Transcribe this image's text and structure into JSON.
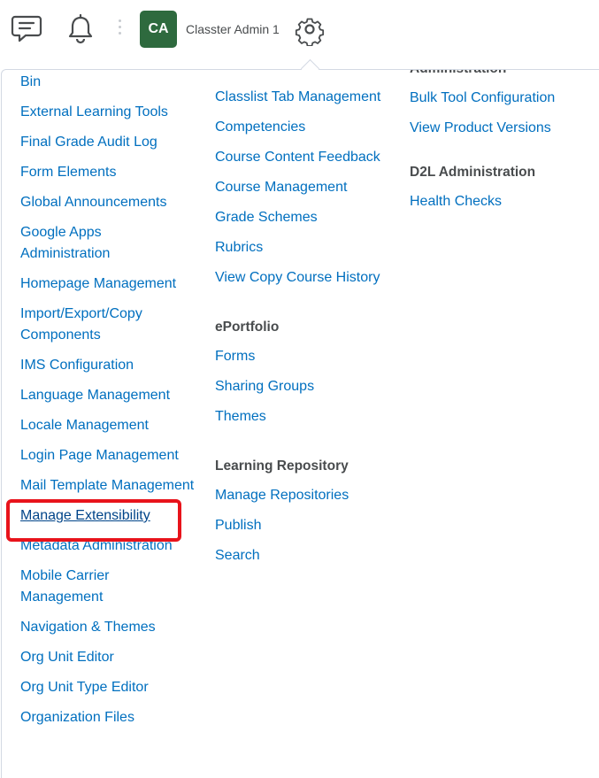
{
  "header": {
    "messages_icon": "chat-bubble-icon",
    "notifications_icon": "bell-icon",
    "avatar_initials": "CA",
    "avatar_color": "#2e6a3e",
    "user_name": "Classter Admin 1",
    "settings_icon": "gear-icon"
  },
  "menu": {
    "column_1": {
      "items": [
        "Bin",
        "External Learning Tools",
        "Final Grade Audit Log",
        "Form Elements",
        "Global Announcements",
        "Google Apps Administration",
        "Homepage Management",
        "Import/Export/Copy Components",
        "IMS Configuration",
        "Language Management",
        "Locale Management",
        "Login Page Management",
        "Mail Template Management",
        "Manage Extensibility",
        "Metadata Administration",
        "Mobile Carrier Management",
        "Navigation & Themes",
        "Org Unit Editor",
        "Org Unit Type Editor",
        "Organization Files"
      ]
    },
    "column_2": {
      "course_items": [
        "Classlist Tab Management",
        "Competencies",
        "Course Content Feedback",
        "Course Management",
        "Grade Schemes",
        "Rubrics",
        "View Copy Course History"
      ],
      "eportfolio": {
        "heading": "ePortfolio",
        "items": [
          "Forms",
          "Sharing Groups",
          "Themes"
        ]
      },
      "learning_repository": {
        "heading": "Learning Repository",
        "items": [
          "Manage Repositories",
          "Publish",
          "Search"
        ]
      }
    },
    "column_3": {
      "partial_heading": "Administration",
      "admin_items": [
        "Bulk Tool Configuration",
        "View Product Versions"
      ],
      "d2l": {
        "heading": "D2L Administration",
        "items": [
          "Health Checks"
        ]
      }
    },
    "link_color": "#006fbf",
    "highlight_color": "#e8131b"
  }
}
